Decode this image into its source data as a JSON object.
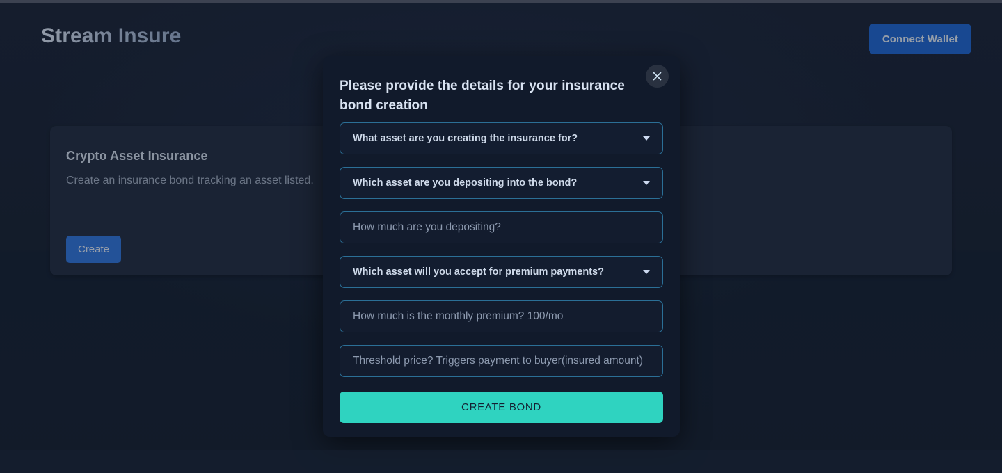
{
  "header": {
    "brand": "Stream Insure",
    "connect_wallet_label": "Connect Wallet"
  },
  "card": {
    "title": "Crypto Asset Insurance",
    "description": "Create an insurance bond tracking an asset listed.",
    "create_label": "Create"
  },
  "modal": {
    "title": "Please provide the details for your insurance bond creation",
    "close_icon": "close-icon",
    "fields": [
      {
        "type": "select",
        "label": "What asset are you creating the insurance for?",
        "name": "insured-asset-select"
      },
      {
        "type": "select",
        "label": "Which asset are you depositing into the bond?",
        "name": "deposit-asset-select"
      },
      {
        "type": "input",
        "label": "How much are you depositing?",
        "name": "deposit-amount-input"
      },
      {
        "type": "select",
        "label": "Which asset will you accept for premium payments?",
        "name": "premium-asset-select"
      },
      {
        "type": "input",
        "label": "How much is the monthly premium? 100/mo",
        "name": "monthly-premium-input"
      },
      {
        "type": "input",
        "label": "Threshold price? Triggers payment to buyer(insured amount)",
        "name": "threshold-price-input"
      }
    ],
    "submit_label": "CREATE BOND"
  },
  "colors": {
    "page_background": "#162030",
    "modal_background": "#111a2b",
    "card_background": "#212b3f",
    "accent_blue": "#1f60c4",
    "accent_teal": "#2fd3c0",
    "field_border": "#2b6f96"
  }
}
